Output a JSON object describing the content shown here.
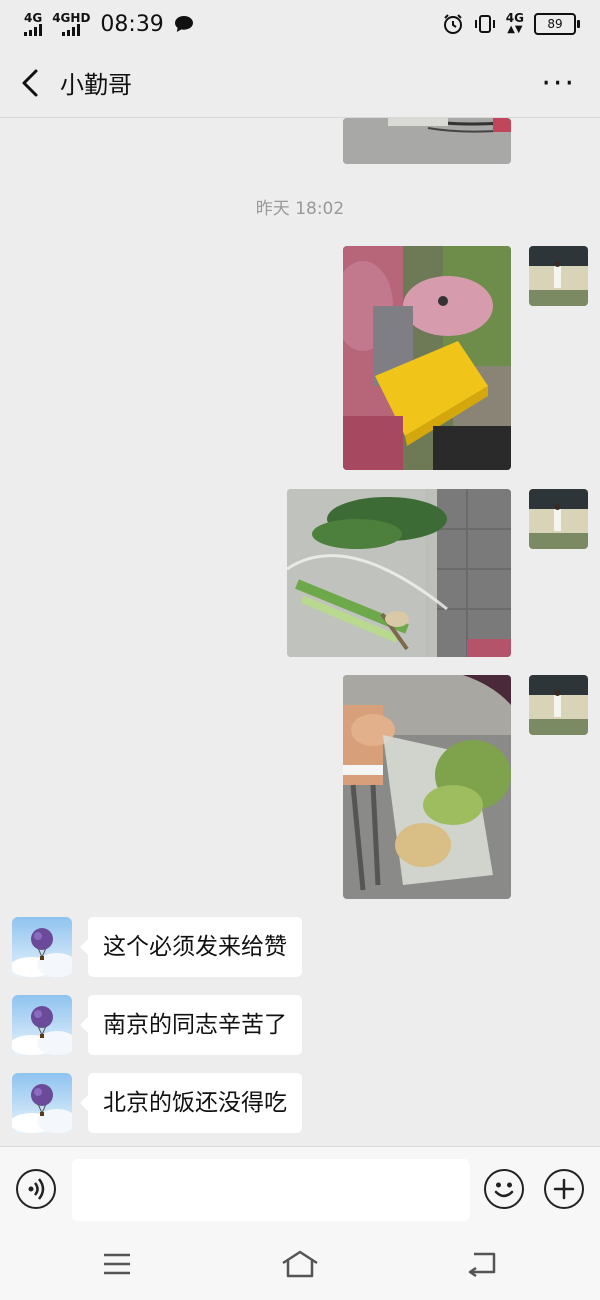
{
  "status_bar": {
    "network_1": "4G",
    "network_2": "4GHD",
    "time": "08:39",
    "network_3": "4G",
    "battery": "89",
    "icons": [
      "chat-bubble-icon",
      "alarm-icon",
      "vibrate-icon"
    ]
  },
  "header": {
    "title": "小勤哥",
    "back_icon": "chevron-left-icon",
    "more_label": "···"
  },
  "chat": {
    "timestamp": "昨天 18:02",
    "incoming": [
      {
        "text": "这个必须发来给赞"
      },
      {
        "text": "南京的同志辛苦了"
      },
      {
        "text": "北京的饭还没得吃"
      }
    ]
  },
  "input_bar": {
    "voice_icon": "voice-icon",
    "placeholder": "",
    "emoji_icon": "emoji-icon",
    "plus_icon": "plus-icon"
  },
  "nav_bar": {
    "icons": [
      "menu-icon",
      "home-icon",
      "back-icon"
    ]
  }
}
